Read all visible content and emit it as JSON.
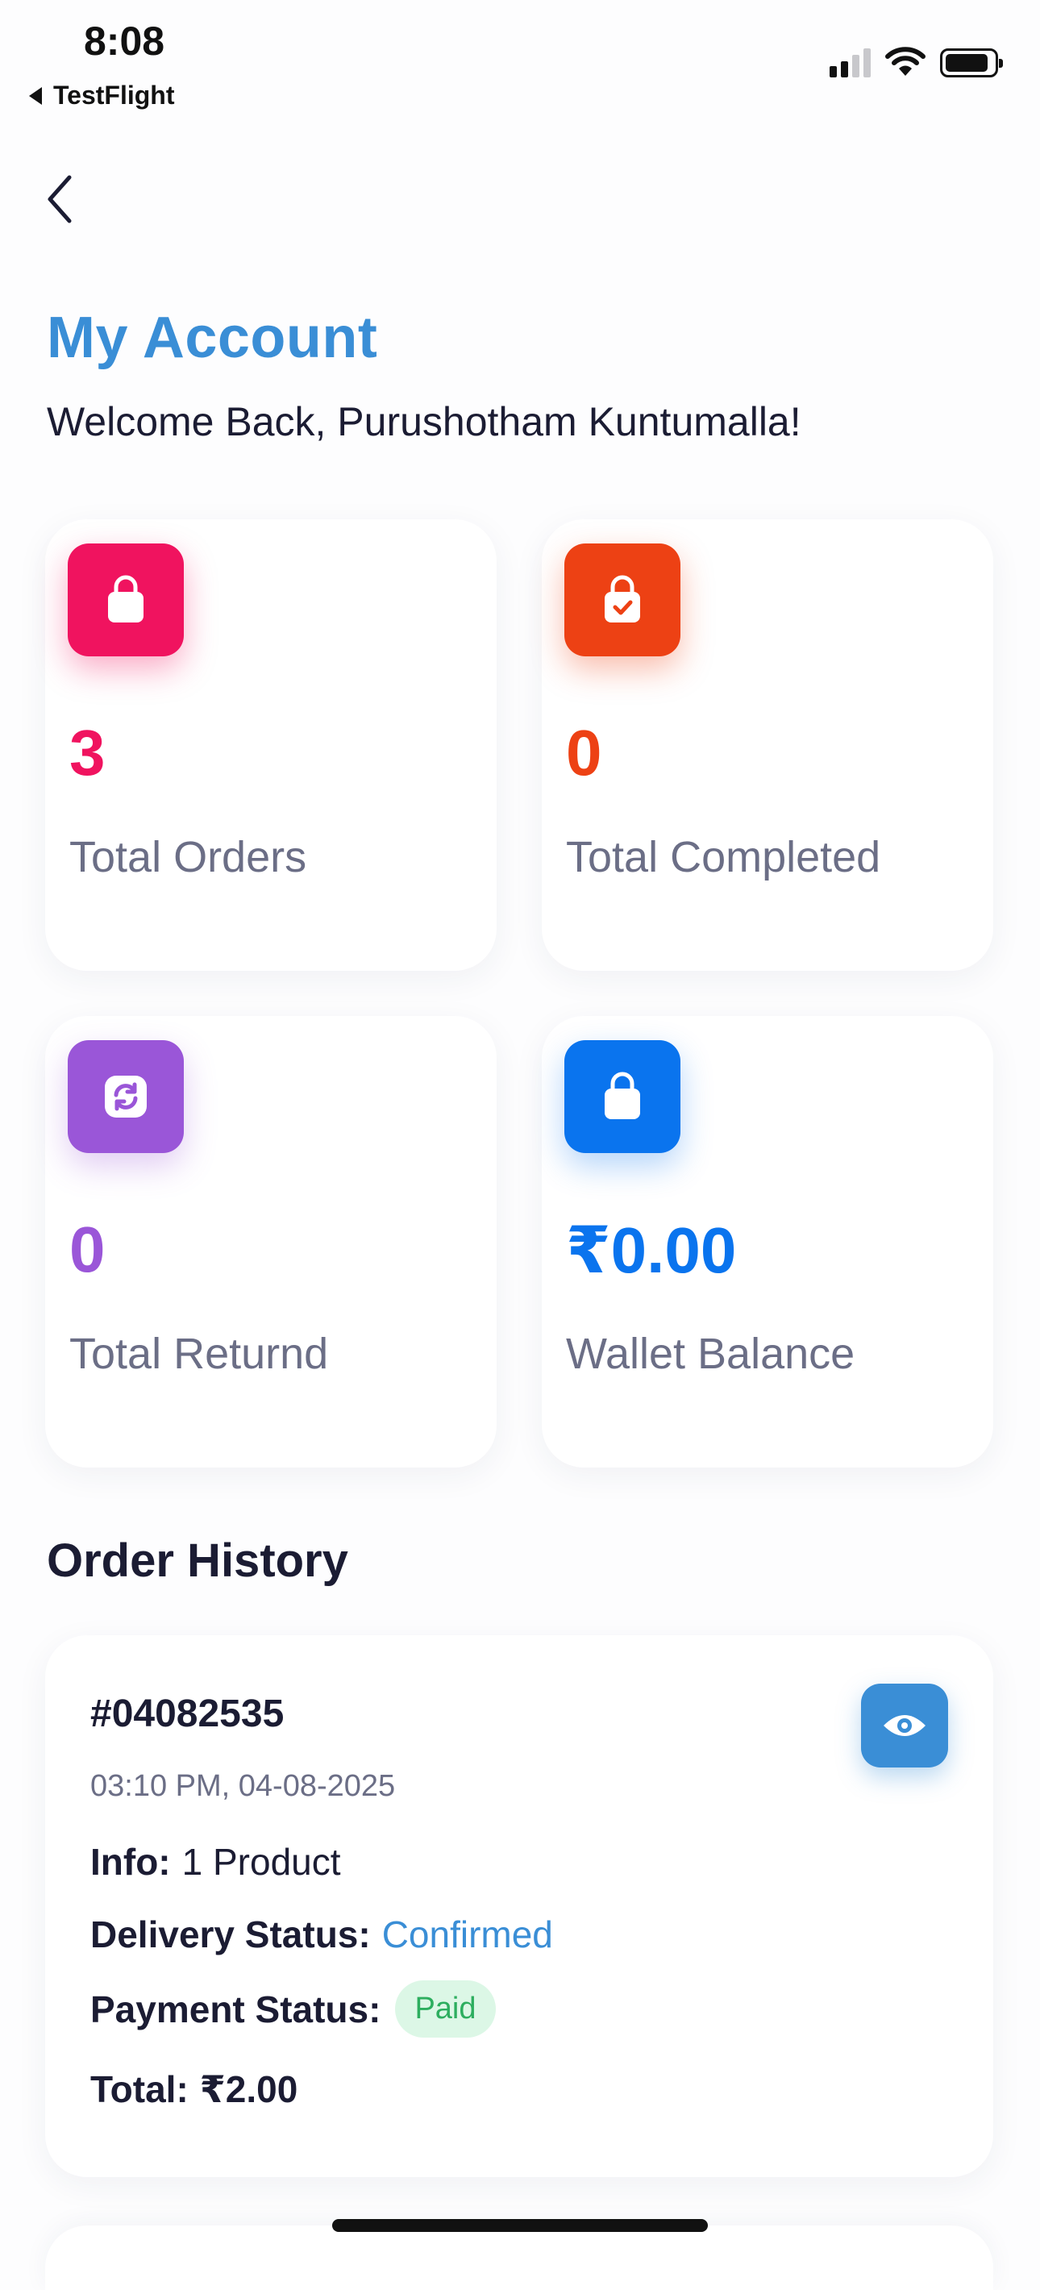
{
  "status_bar": {
    "time": "8:08",
    "back_app": "TestFlight"
  },
  "header": {
    "back_icon": "chevron-left-icon",
    "title": "My Account",
    "welcome": "Welcome Back, Purushotham Kuntumalla!"
  },
  "stats": [
    {
      "value": "3",
      "label": "Total Orders",
      "icon": "shopping-bag-icon",
      "color": "#f0135f"
    },
    {
      "value": "0",
      "label": "Total Completed",
      "icon": "bag-check-icon",
      "color": "#ed4114"
    },
    {
      "value": "0",
      "label": "Total Returnd",
      "icon": "refresh-icon",
      "color": "#9a56d8"
    },
    {
      "value": "₹0.00",
      "label": "Wallet Balance",
      "icon": "shopping-bag-icon",
      "color": "#0a74ee"
    }
  ],
  "order_history": {
    "title": "Order History",
    "orders": [
      {
        "id": "#04082535",
        "datetime": "03:10 PM, 04-08-2025",
        "info_label": "Info:",
        "info_value": "1 Product",
        "delivery_label": "Delivery Status:",
        "delivery_value": "Confirmed",
        "payment_label": "Payment Status:",
        "payment_value": "Paid",
        "total_label": "Total:",
        "total_value": "₹2.00"
      }
    ]
  },
  "colors": {
    "accent": "#3a8ed6",
    "text": "#1b1c33",
    "muted": "#6b6e86",
    "paid_bg": "#dcf7e6",
    "paid_text": "#2dae5f"
  }
}
